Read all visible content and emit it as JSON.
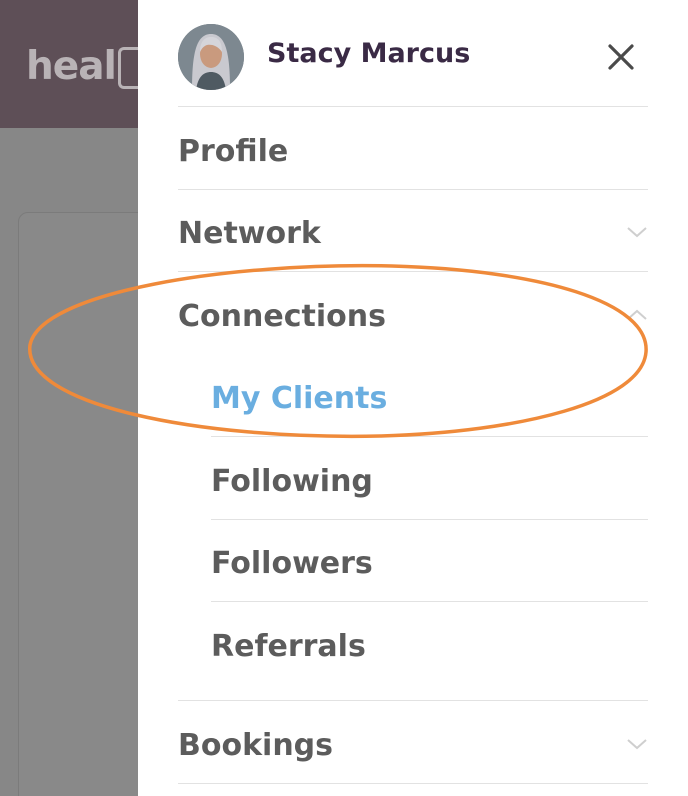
{
  "background": {
    "logo_text": "heal"
  },
  "drawer": {
    "user_name": "Stacy Marcus",
    "menu": {
      "profile": "Profile",
      "network": "Network",
      "connections": "Connections",
      "bookings": "Bookings"
    },
    "connections_submenu": {
      "my_clients": "My Clients",
      "following": "Following",
      "followers": "Followers",
      "referrals": "Referrals"
    }
  },
  "colors": {
    "accent_active": "#6aaee0",
    "annotation_ellipse": "#ef8a3a",
    "username": "#3a2a45"
  }
}
